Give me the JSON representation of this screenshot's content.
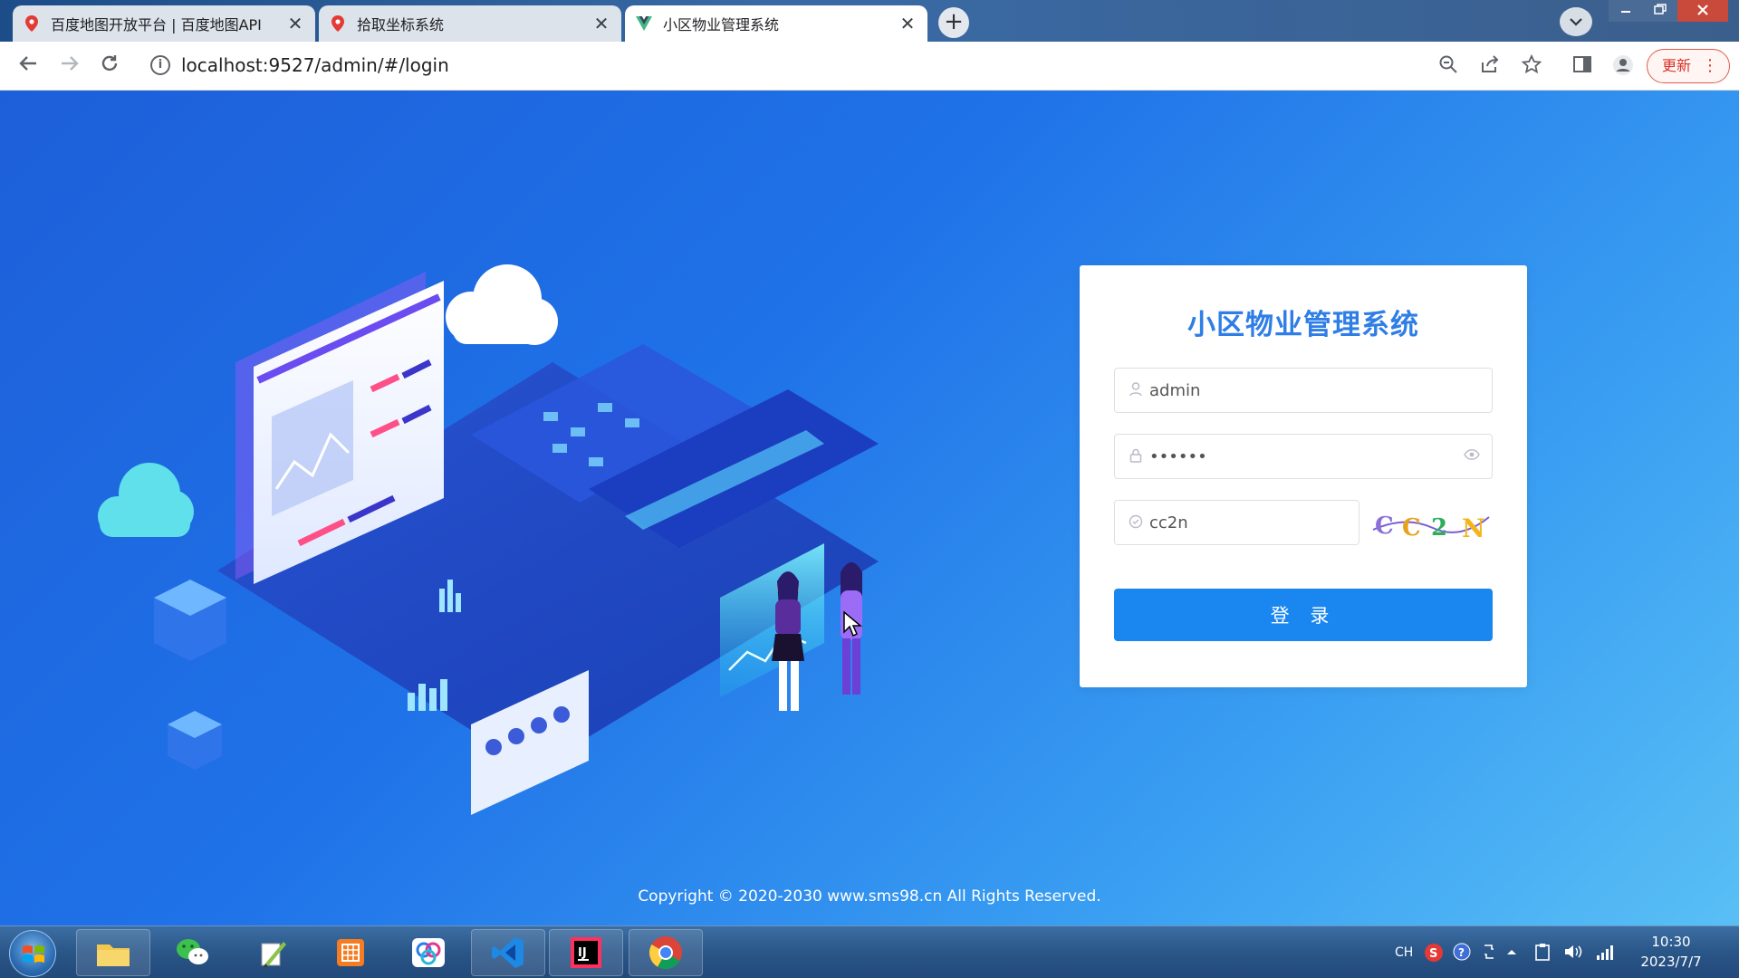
{
  "browser": {
    "tabs": [
      {
        "title": "百度地图开放平台 | 百度地图API",
        "active": false
      },
      {
        "title": "拾取坐标系统",
        "active": false
      },
      {
        "title": "小区物业管理系统",
        "active": true
      }
    ],
    "new_tab_symbol": "+",
    "close_symbol": "✕",
    "url": "localhost:9527/admin/#/login",
    "update_label": "更新"
  },
  "login": {
    "title": "小区物业管理系统",
    "username_value": "admin",
    "password_value": "••••••",
    "captcha_value": "cc2n",
    "captcha_chars": [
      "C",
      "C",
      "2",
      "N"
    ],
    "submit_label": "登 录"
  },
  "footer": {
    "copyright": "Copyright © 2020-2030 www.sms98.cn All Rights Reserved."
  },
  "taskbar": {
    "ime": "CH",
    "time": "10:30",
    "date": "2023/7/7"
  },
  "colors": {
    "accent": "#1a86f0",
    "title": "#2f7ee6"
  },
  "icons": {
    "user_field": "user-icon",
    "password_field": "lock-icon",
    "code_field": "shield-check-icon",
    "password_toggle": "eye-icon"
  }
}
